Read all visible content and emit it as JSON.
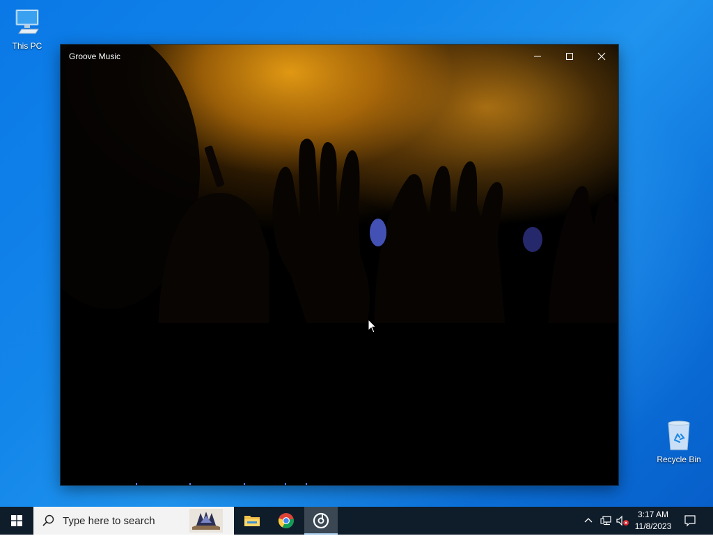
{
  "desktop": {
    "icons": [
      {
        "label": "This PC",
        "icon": "computer-icon"
      },
      {
        "label": "Recycle Bin",
        "icon": "recycle-bin-icon"
      }
    ]
  },
  "window": {
    "title": "Groove Music",
    "buttons": {
      "minimize": "minimize-icon",
      "maximize": "maximize-icon",
      "close": "close-icon"
    },
    "background": "concert crowd hands silhouette"
  },
  "taskbar": {
    "search_placeholder": "Type here to search",
    "apps": [
      "file-explorer-icon",
      "chrome-icon",
      "groove-music-icon"
    ],
    "active_app": "Groove Music"
  },
  "tray": {
    "time": "3:17 AM",
    "date": "11/8/2023"
  },
  "colors": {
    "desktop_blue": "#0a78e6",
    "taskbar": "#0f1d2b",
    "active_app_bg": "#3b4854",
    "accent_orange": "#e6a01a"
  }
}
